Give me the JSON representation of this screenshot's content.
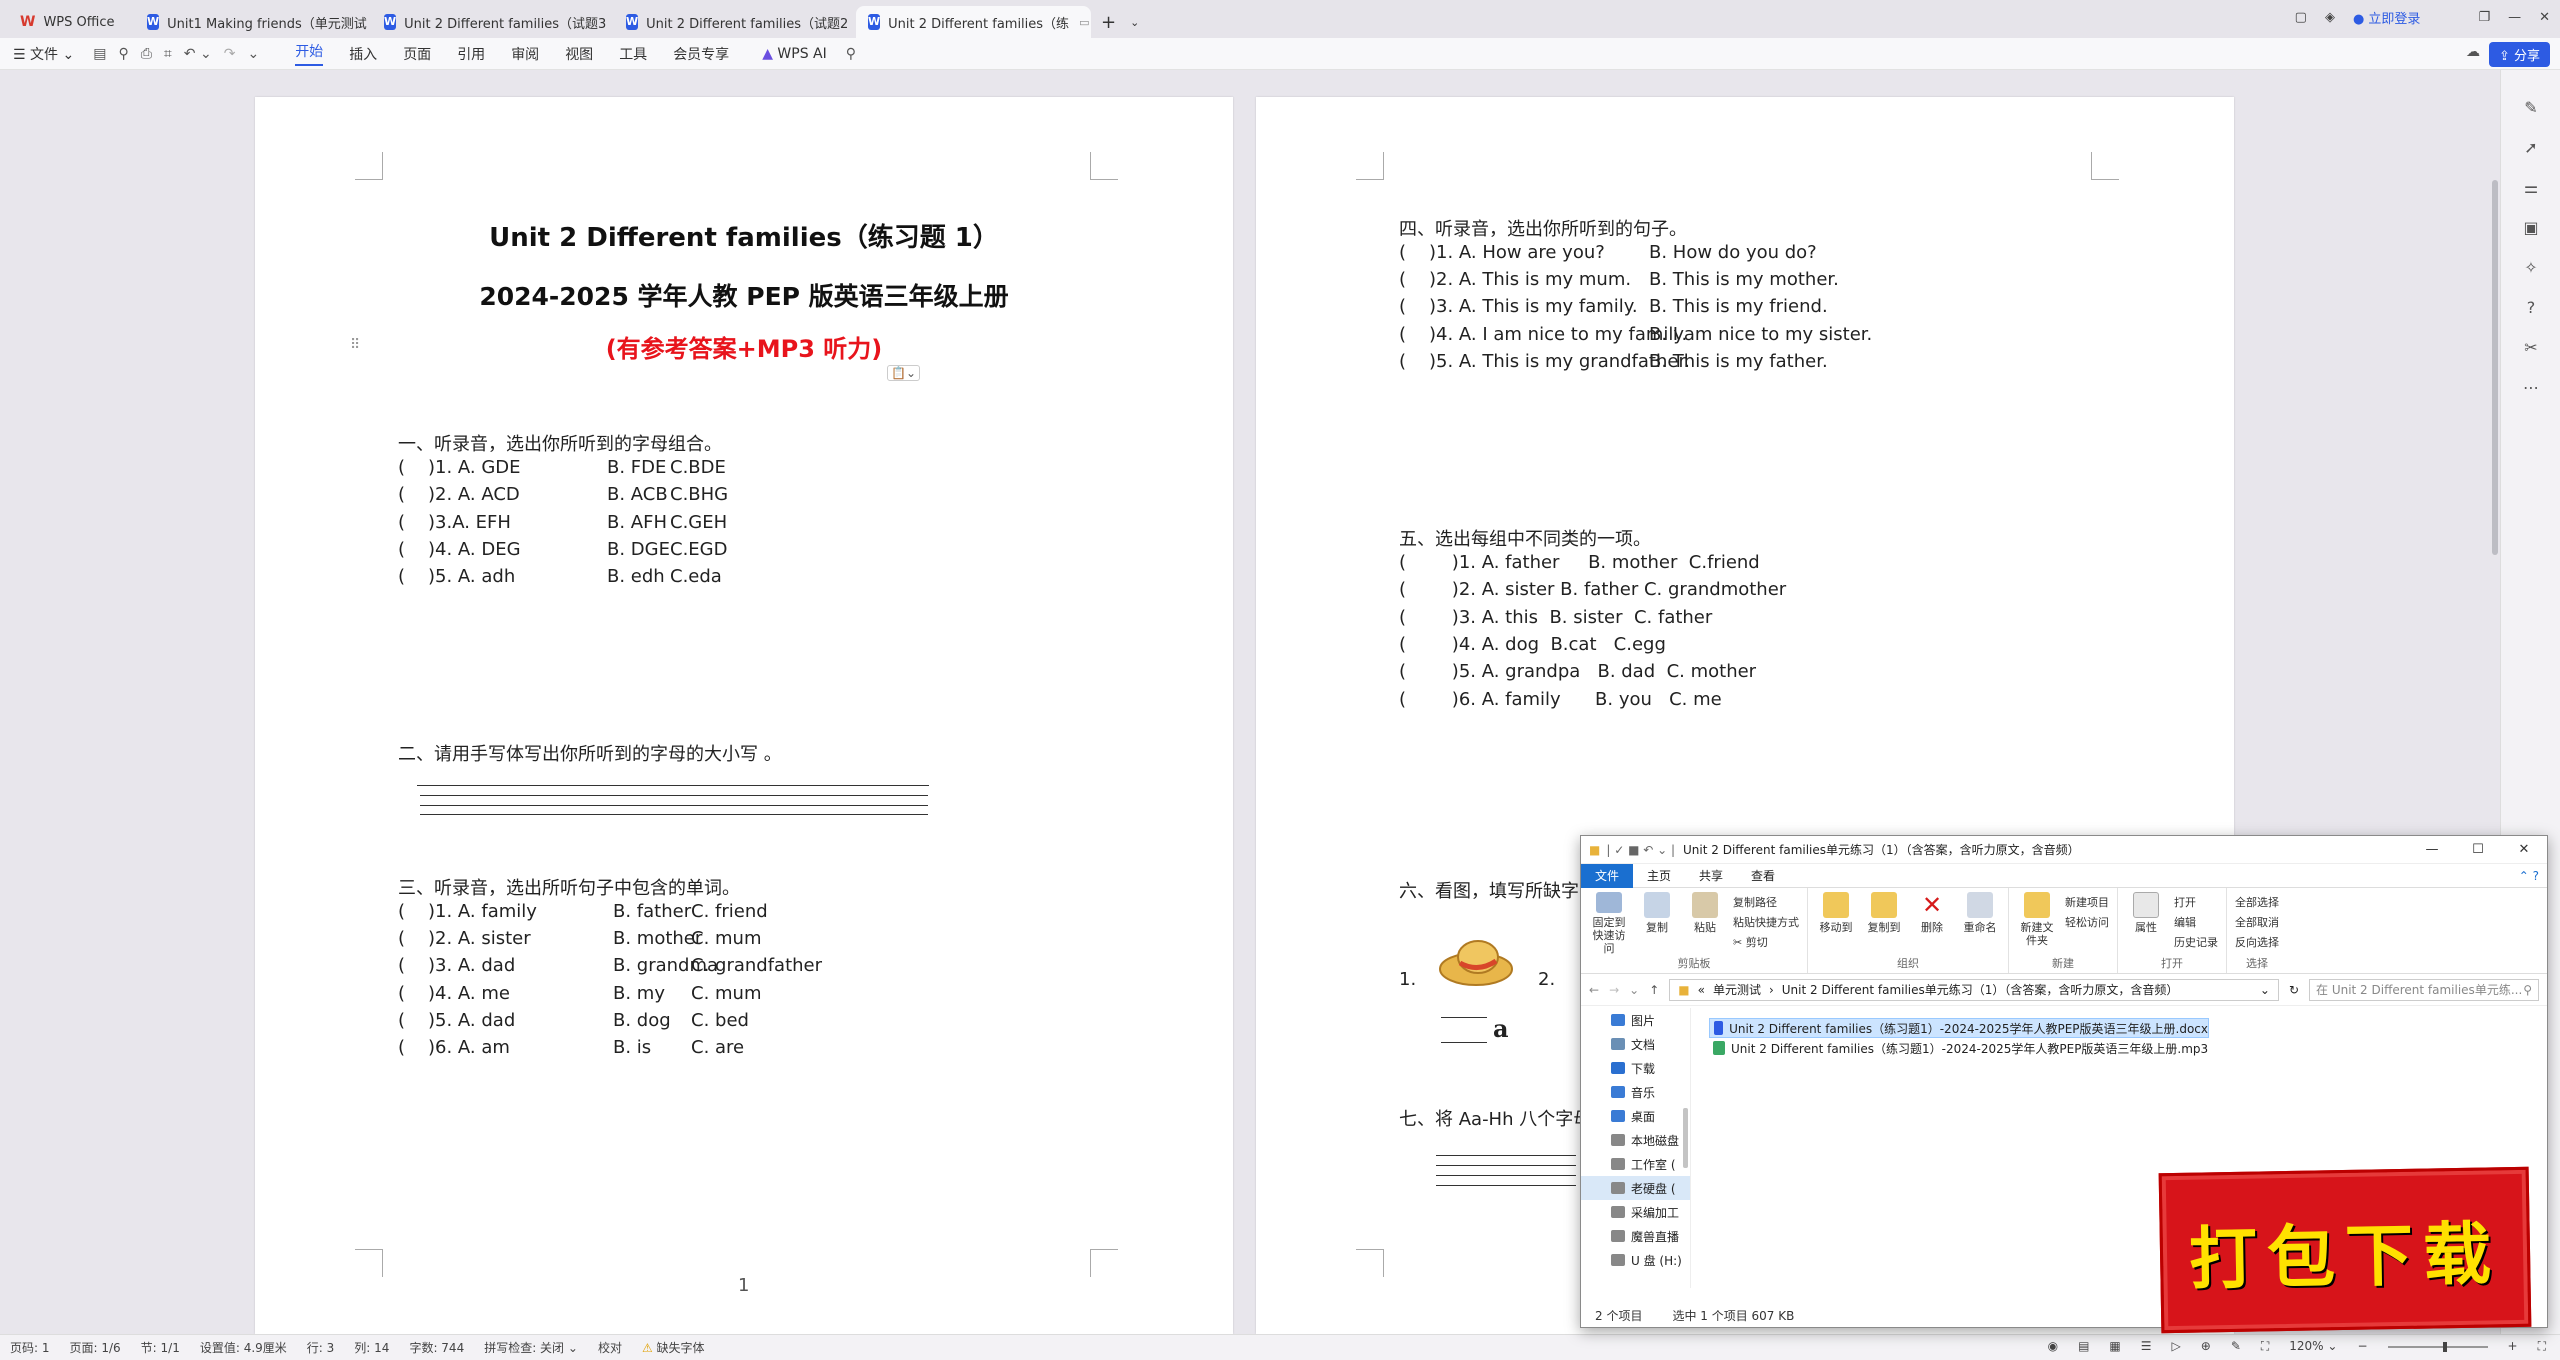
{
  "tabs": [
    {
      "label": "WPS Office",
      "kind": "wps"
    },
    {
      "label": "Unit1 Making friends（单元测试",
      "kind": "doc"
    },
    {
      "label": "Unit 2 Different families（试题3",
      "kind": "doc"
    },
    {
      "label": "Unit 2 Different families（试题2",
      "kind": "doc"
    },
    {
      "label": "Unit 2 Different families（练",
      "kind": "doc"
    }
  ],
  "tabbar": {
    "login": "立即登录",
    "new_tab": "+"
  },
  "toolbar": {
    "file": "文件",
    "menus": [
      "开始",
      "插入",
      "页面",
      "引用",
      "审阅",
      "视图",
      "工具",
      "会员专享"
    ],
    "active": "开始",
    "wps_ai": "WPS AI",
    "share": "分享"
  },
  "page1": {
    "title": "Unit 2 Different families（练习题 1）",
    "subtitle": "2024-2025 学年人教 PEP 版英语三年级上册",
    "note": "(有参考答案+MP3 听力)",
    "sec1": {
      "heading": "一、听录音，选出你所听到的字母组合。",
      "items": [
        [
          "(",
          ")1. A. GDE",
          "B. FDE",
          "C.BDE"
        ],
        [
          "(",
          ")2. A. ACD",
          "B. ACB",
          "C.BHG"
        ],
        [
          "(",
          ")3.A. EFH",
          "B. AFH",
          "C.GEH"
        ],
        [
          "(",
          ")4. A. DEG",
          "B. DGE",
          "C.EGD"
        ],
        [
          "(",
          ")5. A. adh",
          "B. edh",
          "C.eda"
        ]
      ]
    },
    "sec2": {
      "heading": "二、请用手写体写出你所听到的字母的大小写 。"
    },
    "sec3": {
      "heading": "三、听录音，选出所听句子中包含的单词。",
      "items": [
        [
          "(",
          ")1. A. family",
          "B. father",
          "C. friend"
        ],
        [
          "(",
          ")2. A. sister",
          "B. mother",
          "C. mum"
        ],
        [
          "(",
          ")3. A. dad",
          "B. grandma",
          "C. grandfather"
        ],
        [
          "(",
          ")4. A. me",
          "B. my",
          "C. mum"
        ],
        [
          "(",
          ")5. A. dad",
          "B. dog",
          "C. bed"
        ],
        [
          "(",
          ")6. A. am",
          "B. is",
          "C. are"
        ]
      ]
    },
    "page_number": "1"
  },
  "page2": {
    "sec4": {
      "heading": "四、听录音，选出你所听到的句子。",
      "items": [
        [
          "(",
          ")1. A. How are you?",
          "B. How do you do?"
        ],
        [
          "(",
          ")2. A. This is my mum.",
          "B. This is my mother."
        ],
        [
          "(",
          ")3. A. This is my family.",
          "B. This is my friend."
        ],
        [
          "(",
          ")4. A. I am nice to my family.",
          "B. I am nice to my sister."
        ],
        [
          "(",
          ")5. A. This is my grandfather.",
          "B. This is my father."
        ]
      ]
    },
    "sec5": {
      "heading": "五、选出每组中不同类的一项。",
      "items": [
        "(        )1. A. father     B. mother  C.friend",
        "(        )2. A. sister B. father C. grandmother",
        "(        )3. A. this  B. sister  C. father",
        "(        )4. A. dog  B.cat   C.egg",
        "(        )5. A. grandpa   B. dad  C. mother",
        "(        )6. A. family      B. you   C. me"
      ]
    },
    "sec6": {
      "heading": "六、看图，填写所缺字母",
      "n1": "1.",
      "n2": "2.",
      "letter": "a"
    },
    "sec7": {
      "heading": "七、将 Aa-Hh 八个字母"
    }
  },
  "status": {
    "page": "页码: 1",
    "pages": "页面: 1/6",
    "section": "节: 1/1",
    "setting": "设置值: 4.9厘米",
    "row": "行: 3",
    "col": "列: 14",
    "words": "字数: 744",
    "spell": "拼写检查: 关闭",
    "proof": "校对",
    "missing_font": "缺失字体",
    "zoom": "120%"
  },
  "explorer": {
    "title": "Unit 2 Different families单元练习（1）（含答案，含听力原文，含音频）",
    "ribbon_tabs": [
      "文件",
      "主页",
      "共享",
      "查看"
    ],
    "groups": [
      {
        "label": "剪贴板",
        "buttons": [
          "固定到快速访问",
          "复制",
          "粘贴"
        ],
        "small": [
          "复制路径",
          "粘贴快捷方式",
          "剪切"
        ]
      },
      {
        "label": "组织",
        "buttons": [
          "移动到",
          "复制到",
          "删除",
          "重命名"
        ],
        "small": []
      },
      {
        "label": "新建",
        "buttons": [
          "新建文件夹"
        ],
        "small": [
          "新建项目",
          "轻松访问"
        ]
      },
      {
        "label": "打开",
        "buttons": [
          "属性"
        ],
        "small": [
          "打开",
          "编辑",
          "历史记录"
        ]
      },
      {
        "label": "选择",
        "buttons": [],
        "small": [
          "全部选择",
          "全部取消",
          "反向选择"
        ]
      }
    ],
    "address": [
      "«",
      "单元测试",
      "›",
      "Unit 2 Different families单元练习（1）（含答案，含听力原文，含音频）"
    ],
    "search_placeholder": "在 Unit 2 Different families单元练...",
    "nav": [
      "图片",
      "文档",
      "下载",
      "音乐",
      "桌面",
      "本地磁盘",
      "工作室 (",
      "老硬盘 (",
      "采编加工",
      "魔兽直播",
      "U 盘 (H:)"
    ],
    "nav_selected": "老硬盘 (",
    "files": [
      "Unit 2 Different families（练习题1）-2024-2025学年人教PEP版英语三年级上册.docx",
      "Unit 2 Different families（练习题1）-2024-2025学年人教PEP版英语三年级上册.mp3"
    ],
    "status_count": "2 个项目",
    "status_selected": "选中 1 个项目  607 KB"
  },
  "stamp": {
    "text": "打包下载"
  }
}
